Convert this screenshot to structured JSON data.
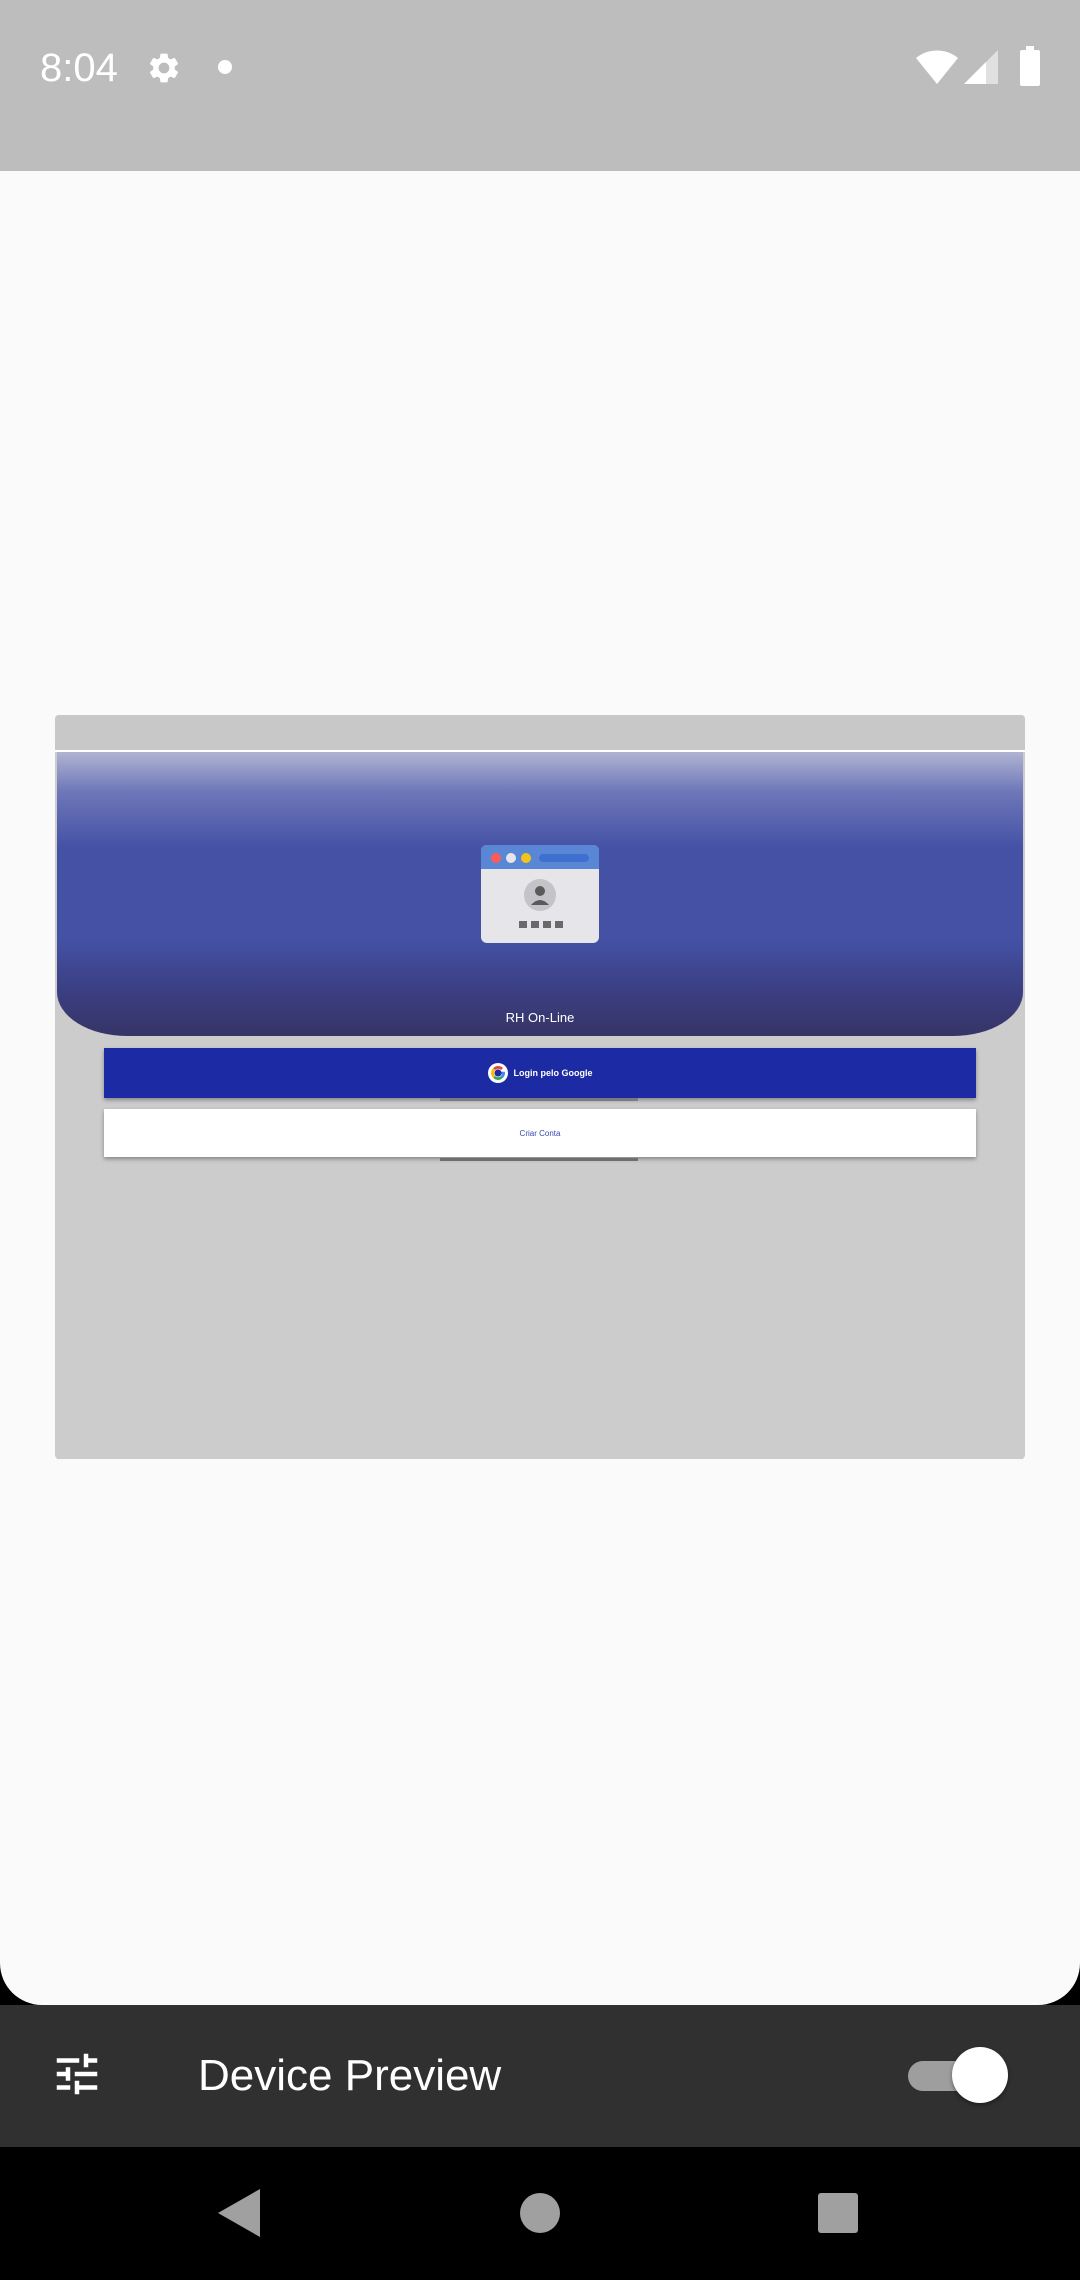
{
  "status_bar": {
    "time": "8:04",
    "icons": [
      "gear-icon",
      "notification-dot-icon",
      "wifi-icon",
      "cell-signal-icon",
      "battery-icon"
    ]
  },
  "device_preview_app": {
    "app_title": "RH On-Line",
    "google_login_label": "Login pelo Google",
    "create_account_label": "Criar Conta",
    "colors": {
      "hero_blue": "#4451a5",
      "google_button": "#1c2aa3",
      "create_account_text": "#3a45b0",
      "preview_background": "#cccccc"
    }
  },
  "bottom_toolbar": {
    "title": "Device Preview",
    "toggle_on": true
  },
  "nav_bar": {
    "buttons": [
      "back-icon",
      "home-icon",
      "recents-icon"
    ]
  }
}
